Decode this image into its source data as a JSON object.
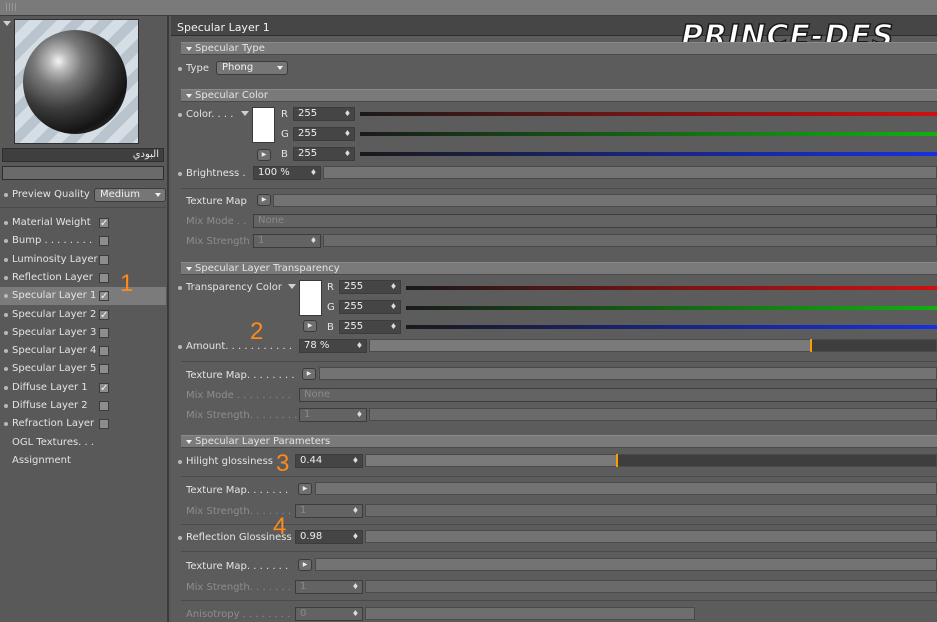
{
  "window": {
    "grip_icon": "grip-icon"
  },
  "left": {
    "preview_icon": "material-sphere-preview",
    "material_name": "البودي",
    "preview_quality": {
      "label": "Preview Quality",
      "value": "Medium"
    },
    "channels": [
      {
        "label": "Material Weight",
        "checked": true,
        "selected": false
      },
      {
        "label": "Bump . . . . . . . .",
        "checked": false,
        "selected": false
      },
      {
        "label": "Luminosity Layer",
        "checked": false,
        "selected": false
      },
      {
        "label": "Reflection Layer",
        "checked": false,
        "selected": false
      },
      {
        "label": "Specular Layer 1",
        "checked": true,
        "selected": true
      },
      {
        "label": "Specular Layer 2",
        "checked": true,
        "selected": false
      },
      {
        "label": "Specular Layer 3",
        "checked": false,
        "selected": false
      },
      {
        "label": "Specular Layer 4",
        "checked": false,
        "selected": false
      },
      {
        "label": "Specular Layer 5",
        "checked": false,
        "selected": false
      },
      {
        "label": "Diffuse Layer 1",
        "checked": true,
        "selected": false
      },
      {
        "label": "Diffuse Layer 2",
        "checked": false,
        "selected": false
      },
      {
        "label": "Refraction Layer",
        "checked": false,
        "selected": false
      },
      {
        "label": "OGL Textures. . .",
        "checked": null,
        "selected": false
      },
      {
        "label": "Assignment",
        "checked": null,
        "selected": false
      }
    ]
  },
  "right": {
    "title": "Specular Layer 1",
    "watermark": "PRINCE-DES",
    "specular_type": {
      "header": "Specular Type",
      "type_label": "Type",
      "type_value": "Phong"
    },
    "specular_color": {
      "header": "Specular Color",
      "color_label": "Color. . . .",
      "r_label": "R",
      "r_value": "255",
      "g_label": "G",
      "g_value": "255",
      "b_label": "B",
      "b_value": "255",
      "brightness_label": "Brightness .",
      "brightness_value": "100 %",
      "texture_map_label": "Texture Map",
      "mix_mode_label": "Mix Mode . .",
      "mix_mode_value": "None",
      "mix_strength_label": "Mix Strength",
      "mix_strength_value": "1"
    },
    "transparency": {
      "header": "Specular Layer Transparency",
      "color_label": "Transparency Color",
      "r_label": "R",
      "r_value": "255",
      "g_label": "G",
      "g_value": "255",
      "b_label": "B",
      "b_value": "255",
      "amount_label": "Amount. . . . . . . . . . .",
      "amount_value": "78 %",
      "amount_fraction": 0.78,
      "texture_map_label": "Texture Map. . . . . . . .",
      "mix_mode_label": "Mix Mode . . . . . . . . .",
      "mix_mode_value": "None",
      "mix_strength_label": "Mix Strength. . . . . . . .",
      "mix_strength_value": "1"
    },
    "parameters": {
      "header": "Specular Layer Parameters",
      "hilight_label": "Hilight glossiness",
      "hilight_value": "0.44",
      "hilight_fraction": 0.44,
      "texture_map_label": "Texture Map. . . . . . .",
      "mix_strength_label": "Mix Strength. . . . . . .",
      "mix_strength_value": "1",
      "refl_gloss_label": "Reflection Glossiness",
      "refl_gloss_value": "0.98",
      "texture_map2_label": "Texture Map. . . . . . .",
      "mix_strength2_label": "Mix Strength. . . . . . .",
      "mix_strength2_value": "1",
      "anisotropy_label": "Anisotropy . . . . . . . .",
      "anisotropy_value": "0"
    },
    "annotations": [
      "1",
      "2",
      "3",
      "4"
    ]
  },
  "colors": {
    "accent": "#ff8a1c",
    "red": "#d01010",
    "green": "#10b010",
    "blue": "#1830e0"
  }
}
